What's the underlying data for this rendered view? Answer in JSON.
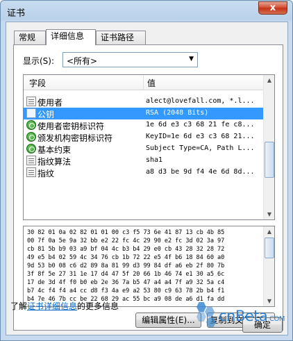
{
  "window": {
    "title": "证书",
    "close_glyph": "x"
  },
  "tabs": [
    {
      "label": "常规"
    },
    {
      "label": "详细信息"
    },
    {
      "label": "证书路径"
    }
  ],
  "show": {
    "label": "显示(S):",
    "selected": "<所有>"
  },
  "list": {
    "headers": {
      "field": "字段",
      "value": "值"
    },
    "rows": [
      {
        "field": "使用者",
        "value": "alect@lovefall.com, *.l...",
        "icon": "certificate-field-icon"
      },
      {
        "field": "公钥",
        "value": "RSA (2048 Bits)",
        "icon": "key-icon",
        "selected": true
      },
      {
        "field": "使用者密钥标识符",
        "value": "1e 6d e3 c3 68 21 fe c8...",
        "icon": "extension-icon"
      },
      {
        "field": "颁发机构密钥标识符",
        "value": "KeyID=1e 6d e3 c3 68 21...",
        "icon": "extension-icon"
      },
      {
        "field": "基本约束",
        "value": "Subject Type=CA, Path L...",
        "icon": "extension-icon"
      },
      {
        "field": "指纹算法",
        "value": "sha1",
        "icon": "certificate-field-icon"
      },
      {
        "field": "指纹",
        "value": "a8 d3 be 9d f4 4e 6d 8d...",
        "icon": "certificate-field-icon"
      }
    ]
  },
  "detail": {
    "lines": [
      "30 82 01 0a 02 82 01 01 00 c3 f5 73 6e 41 87 13 cb 4b 85",
      "00 7f 0a 5e 9a 32 bb e2 22 fc 4c 29 90 e2 fc 3d 02 3a 97",
      "cb 81 5b b9 03 a9 bf 04 4c b3 b4 29 e0 cb 43 28 32 28 72",
      "49 e5 b4 02 59 4c 34 76 cb 1b 72 22 e5 4f b6 18 84 60 a0",
      "9d 53 b0 08 c6 d2 89 8a 81 99 d3 99 84 df a6 eb 2f 80 7b",
      "3f 8f 5e 27 31 1e 17 d4 47 5f 20 66 1b 46 74 e1 30 a5 6c",
      "17 de 3d 4f f0 b0 eb 2e 36 7a b5 47 a4 a4 7f a9 32 5a c4",
      "b7 4c f4 f4 a4 cc d8 f3 4a e9 a2 53 80 c9 63 78 2b b4 f1",
      "b4 7e 46 7b cc be 22 68 29 ac 55 bc a9 08 de a6 d1 fa dd"
    ]
  },
  "buttons": {
    "edit_properties": "编辑属性(E)...",
    "copy_to_file": "复制到文件(C)...",
    "ok": "确定"
  },
  "learn_more": {
    "prefix": "了解",
    "link": "证书详细信息",
    "suffix": "的更多信息"
  },
  "watermark": {
    "text": "cnBeta",
    "suffix": ".COM"
  },
  "colors": {
    "selection": "#3399ff",
    "link": "#0066cc",
    "title_bar": "#b9d1ea"
  }
}
